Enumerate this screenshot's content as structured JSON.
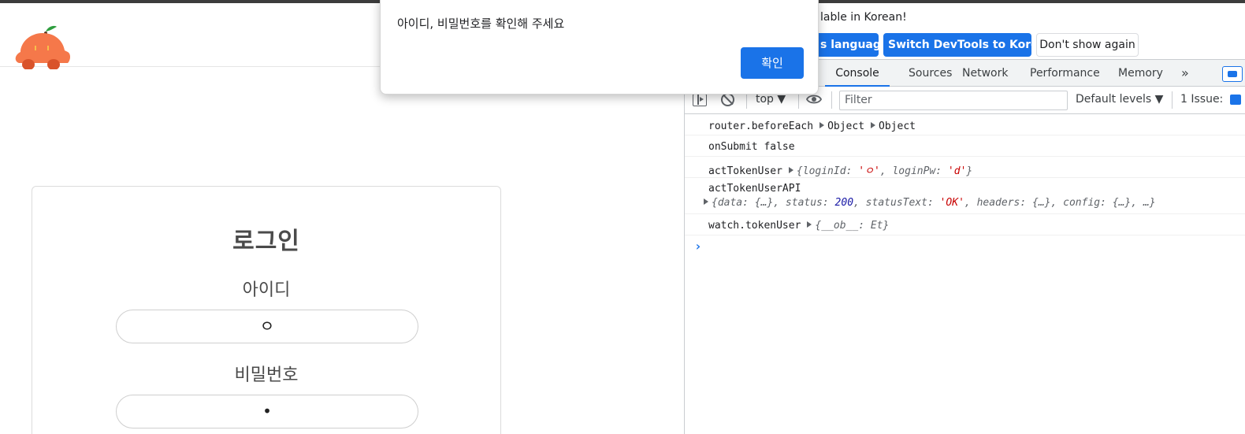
{
  "app": {
    "login": {
      "title": "로그인",
      "id_label": "아이디",
      "id_value": "ㅇ",
      "pw_label": "비밀번호",
      "pw_value": "•"
    }
  },
  "dialog": {
    "message": "아이디, 비밀번호를 확인해 주세요",
    "ok_label": "확인"
  },
  "devtools": {
    "infobar": {
      "message": "lable in Korean!",
      "lang_button": "s language",
      "switch_button": "Switch DevTools to Korean",
      "dont_show_button": "Don't show again"
    },
    "tabs": {
      "console": "Console",
      "sources": "Sources",
      "network": "Network",
      "performance": "Performance",
      "memory": "Memory",
      "more": "»"
    },
    "toolbar": {
      "context": "top ▼",
      "filter_placeholder": "Filter",
      "levels": "Default levels ▼",
      "issues": "1 Issue:"
    },
    "console": {
      "log1_text": "router.beforeEach",
      "log1_obj1": "Object",
      "log1_obj2": "Object",
      "log2_text": "onSubmit false",
      "log3_text": "actTokenUser",
      "log3_open": "{loginId: ",
      "log3_id": "'ㅇ'",
      "log3_mid": ", loginPw: ",
      "log3_pw": "'d'",
      "log3_close": "}",
      "log4_text": "actTokenUserAPI",
      "log4_a": "{data: {…}, status: ",
      "log4_status": "200",
      "log4_b": ", statusText: ",
      "log4_ok": "'OK'",
      "log4_c": ", headers: {…}, config: {…}, …}",
      "log5_text": "watch.tokenUser",
      "log5_obj": "{__ob__: Et}",
      "prompt": "›"
    }
  },
  "colors": {
    "accent": "#1a73e8",
    "logo_orange": "#f5784a",
    "logo_leaf": "#2e9e3e"
  }
}
